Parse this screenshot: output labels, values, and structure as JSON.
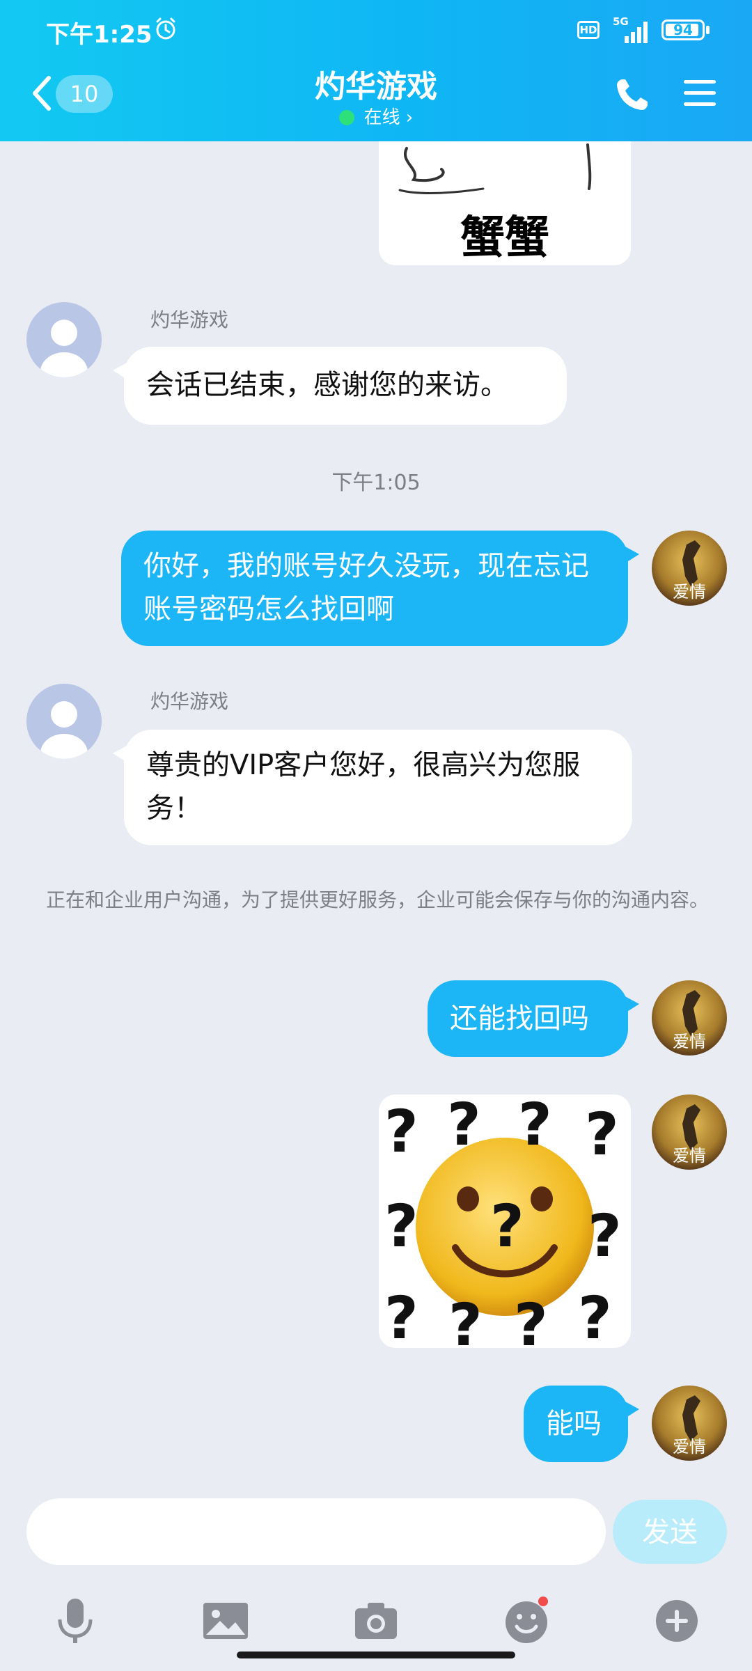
{
  "status_bar": {
    "time": "下午1:25",
    "hd_label": "HD",
    "network_label": "5G",
    "battery_level": "94"
  },
  "header": {
    "back_count": "10",
    "title": "灼华游戏",
    "online_status": "在线 ›"
  },
  "messages": [
    {
      "type": "sticker_partial",
      "sender": "",
      "sticker_caption": "蟹蟹"
    },
    {
      "type": "incoming",
      "sender": "灼华游戏",
      "text": "会话已结束，感谢您的来访。"
    },
    {
      "type": "time",
      "text": "下午1:05"
    },
    {
      "type": "outgoing",
      "text": "你好，我的账号好久没玩，现在忘记账号密码怎么找回啊"
    },
    {
      "type": "incoming",
      "sender": "灼华游戏",
      "text": "尊贵的VIP客户您好，很高兴为您服务！"
    },
    {
      "type": "system",
      "text": "正在和企业用户沟通，为了提供更好服务，企业可能会保存与你的沟通内容。"
    },
    {
      "type": "outgoing",
      "text": "还能找回吗"
    },
    {
      "type": "sticker",
      "sticker_name": "question-emoji-sticker"
    },
    {
      "type": "outgoing",
      "text": "能吗"
    }
  ],
  "user_avatar_caption": "爱情",
  "input": {
    "placeholder": "",
    "send_label": "发送"
  },
  "colors": {
    "header": "#13c9f2",
    "bubble_out": "#1cb6f6",
    "bubble_in": "#ffffff",
    "background": "#eaecf3",
    "send_disabled": "#b8ecfb"
  }
}
